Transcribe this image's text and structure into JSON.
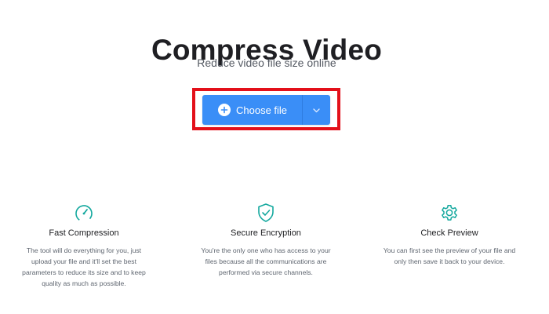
{
  "hero": {
    "title": "Compress Video",
    "subtitle": "Reduce video file size online"
  },
  "upload": {
    "button_label": "Choose file",
    "button_icon": "plus-circle-icon",
    "dropdown_icon": "chevron-down-icon",
    "accent_color": "#3a8ef7",
    "highlight_color": "#e3101a"
  },
  "features": [
    {
      "icon": "speedometer-icon",
      "title": "Fast Compression",
      "text": "The tool will do everything for you, just upload your file and it'll set the best parameters to reduce its size and to keep quality as much as possible."
    },
    {
      "icon": "shield-check-icon",
      "title": "Secure Encryption",
      "text": "You're the only one who has access to your files because all the communications are performed via secure channels."
    },
    {
      "icon": "gear-icon",
      "title": "Check Preview",
      "text": "You can first see the preview of your file and only then save it back to your device."
    }
  ],
  "icon_color": "#13a89e"
}
